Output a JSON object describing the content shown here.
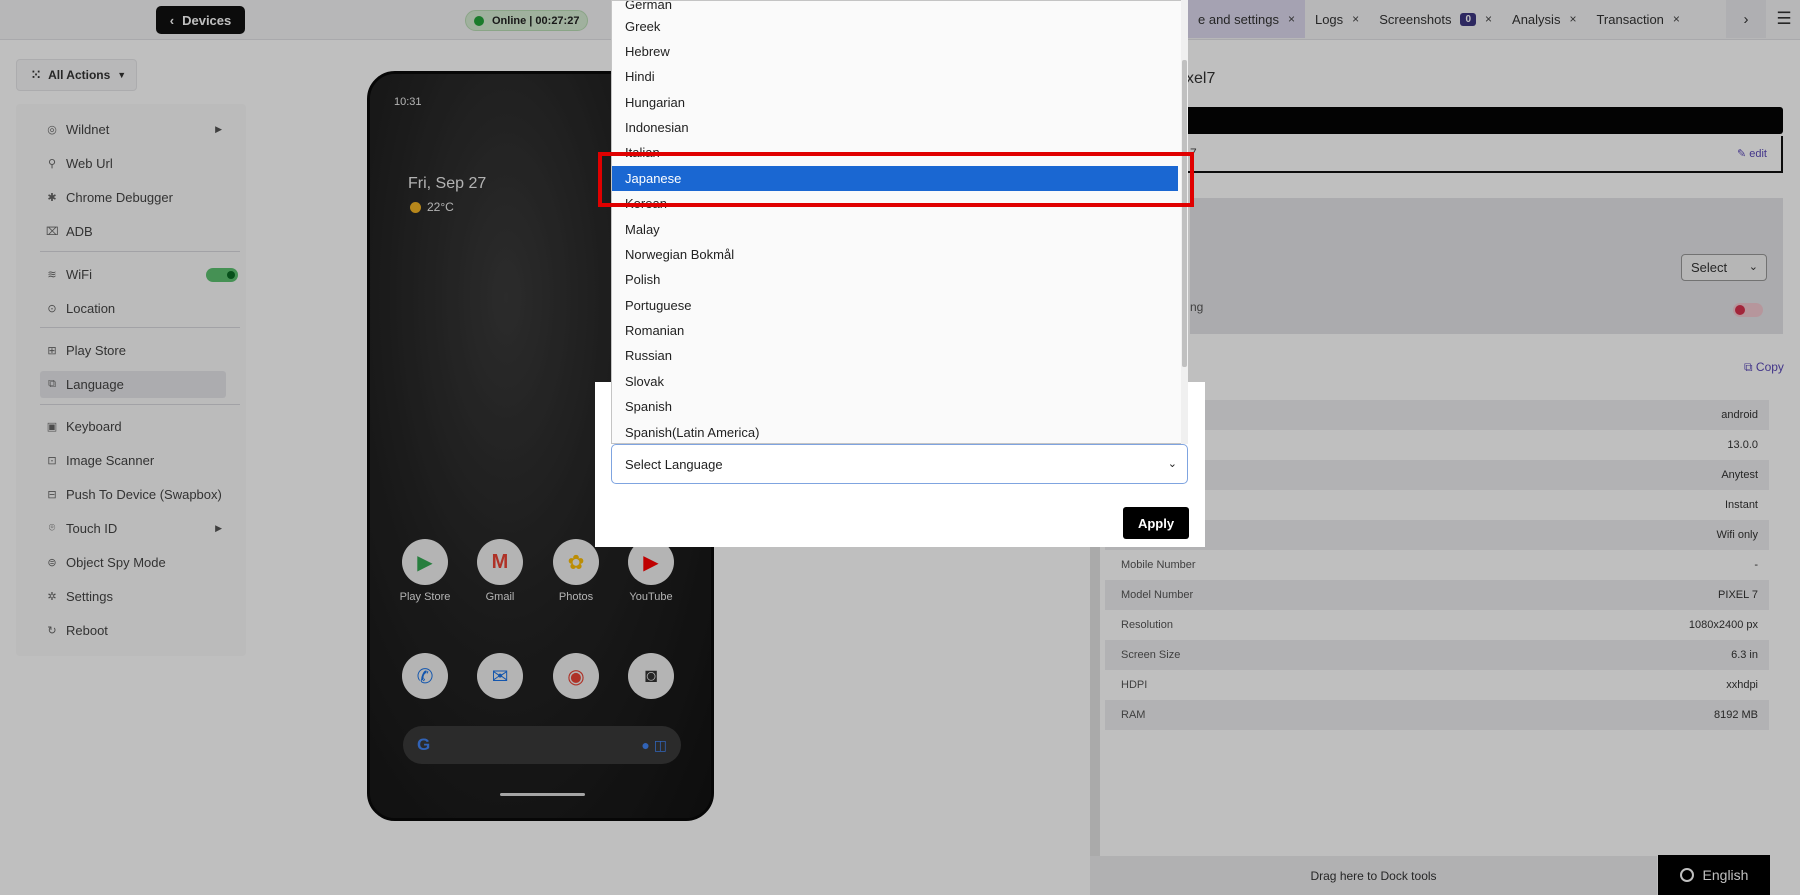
{
  "topbar": {
    "devices_label": "Devices",
    "status": "Online | 00:27:27",
    "tabs": [
      {
        "label": "e and settings",
        "badge": ""
      },
      {
        "label": "Logs",
        "badge": ""
      },
      {
        "label": "Screenshots",
        "badge": "0"
      },
      {
        "label": "Analysis",
        "badge": ""
      },
      {
        "label": "Transaction",
        "badge": ""
      }
    ],
    "close_glyph": "×"
  },
  "all_actions_label": "All Actions",
  "sidebar": {
    "items": [
      {
        "label": "Wildnet",
        "icon": "wildnet-icon",
        "glyph": "◎"
      },
      {
        "label": "Web Url",
        "icon": "link-icon",
        "glyph": "⚲"
      },
      {
        "label": "Chrome Debugger",
        "icon": "bug-icon",
        "glyph": "✱"
      },
      {
        "label": "ADB",
        "icon": "adb-icon",
        "glyph": "⌧"
      },
      {
        "label": "WiFi",
        "icon": "wifi-icon",
        "glyph": "≋"
      },
      {
        "label": "Location",
        "icon": "location-icon",
        "glyph": "⊙"
      },
      {
        "label": "Play Store",
        "icon": "play-store-icon",
        "glyph": "⊞"
      },
      {
        "label": "Language",
        "icon": "language-icon",
        "glyph": "⧉"
      },
      {
        "label": "Keyboard",
        "icon": "keyboard-icon",
        "glyph": "▣"
      },
      {
        "label": "Image Scanner",
        "icon": "image-scanner-icon",
        "glyph": "⊡"
      },
      {
        "label": "Push To Device (Swapbox)",
        "icon": "push-icon",
        "glyph": "⊟"
      },
      {
        "label": "Touch ID",
        "icon": "fingerprint-icon",
        "glyph": "⌾"
      },
      {
        "label": "Object Spy Mode",
        "icon": "spy-icon",
        "glyph": "⊜"
      },
      {
        "label": "Settings",
        "icon": "gear-icon",
        "glyph": "✲"
      },
      {
        "label": "Reboot",
        "icon": "reboot-icon",
        "glyph": "↻"
      }
    ]
  },
  "phone": {
    "time": "10:31",
    "date": "Fri, Sep 27",
    "weather": "22°C",
    "apps_row1": [
      {
        "label": "Play Store",
        "glyph": "▶",
        "color": "#34a853"
      },
      {
        "label": "Gmail",
        "glyph": "M",
        "color": "#ea4335"
      },
      {
        "label": "Photos",
        "glyph": "✿",
        "color": "#fbbc05"
      },
      {
        "label": "YouTube",
        "glyph": "▶",
        "color": "#ff0000"
      }
    ],
    "apps_row2": [
      {
        "label": "",
        "glyph": "✆",
        "color": "#1a73e8"
      },
      {
        "label": "",
        "glyph": "✉",
        "color": "#1a73e8"
      },
      {
        "label": "",
        "glyph": "◉",
        "color": "#ea4335"
      },
      {
        "label": "",
        "glyph": "◙",
        "color": "#333333"
      }
    ],
    "search_glyph": "G"
  },
  "right_panel": {
    "title_fragment": "xel7",
    "device_fragment": "7",
    "edit_label": "edit",
    "select_label": "Select",
    "settings_fragment": "ng",
    "copy_label": "Copy",
    "info_rows": [
      {
        "key": "",
        "value": "android"
      },
      {
        "key": "",
        "value": "13.0.0"
      },
      {
        "key": "",
        "value": "Anytest"
      },
      {
        "key": "",
        "value": "Instant"
      },
      {
        "key": "",
        "value": "Wifi only"
      },
      {
        "key": "Mobile Number",
        "value": "-"
      },
      {
        "key": "Model Number",
        "value": "PIXEL 7"
      },
      {
        "key": "Resolution",
        "value": "1080x2400 px"
      },
      {
        "key": "Screen Size",
        "value": "6.3 in"
      },
      {
        "key": "HDPI",
        "value": "xxhdpi"
      },
      {
        "key": "RAM",
        "value": "8192 MB"
      }
    ],
    "dock_label": "Drag here to Dock tools",
    "language_button": "English"
  },
  "modal": {
    "select_placeholder": "Select Language",
    "apply_label": "Apply",
    "options": [
      "German",
      "Greek",
      "Hebrew",
      "Hindi",
      "Hungarian",
      "Indonesian",
      "Italian",
      "Japanese",
      "Korean",
      "Malay",
      "Norwegian Bokmål",
      "Polish",
      "Portuguese",
      "Romanian",
      "Russian",
      "Slovak",
      "Spanish",
      "Spanish(Latin America)"
    ],
    "selected_option": "Japanese"
  },
  "colors": {
    "accent": "#1a67d2",
    "highlight": "#e00000",
    "online": "#23a43a"
  }
}
